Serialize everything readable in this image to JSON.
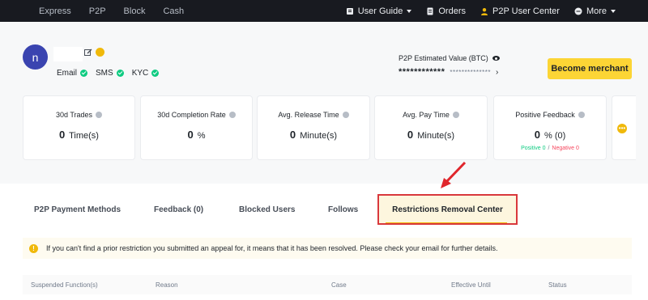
{
  "nav": {
    "left": [
      "Express",
      "P2P",
      "Block",
      "Cash"
    ],
    "right": {
      "user_guide": "User Guide",
      "orders": "Orders",
      "p2p_user_center": "P2P User Center",
      "more": "More"
    }
  },
  "profile": {
    "avatar_letter": "n",
    "verifications": [
      "Email",
      "SMS",
      "KYC"
    ]
  },
  "estimate": {
    "label": "P2P Estimated Value (BTC)",
    "value_masked": "************",
    "sub_masked": "**************"
  },
  "merchant_button": "Become merchant",
  "stats": [
    {
      "title": "30d Trades",
      "value": "0",
      "unit": "Time(s)"
    },
    {
      "title": "30d Completion Rate",
      "value": "0",
      "unit": "%"
    },
    {
      "title": "Avg. Release Time",
      "value": "0",
      "unit": "Minute(s)"
    },
    {
      "title": "Avg. Pay Time",
      "value": "0",
      "unit": "Minute(s)"
    },
    {
      "title": "Positive Feedback",
      "value": "0",
      "unit": "% (0)",
      "positive": "Positive 0",
      "negative": "Negative 0"
    }
  ],
  "tabs": [
    "P2P Payment Methods",
    "Feedback (0)",
    "Blocked Users",
    "Follows",
    "Restrictions Removal Center"
  ],
  "notice": "If you can't find a prior restriction you submitted an appeal for, it means that it has been resolved. Please check your email for further details.",
  "table_headers": [
    "Suspended Function(s)",
    "Reason",
    "Case",
    "Effective Until",
    "Status"
  ],
  "colors": {
    "nav_bg": "#181a20",
    "brand_yellow": "#fcd535",
    "success_green": "#0ecb81",
    "danger_red": "#f6465d",
    "highlight_red": "#d9383c"
  }
}
